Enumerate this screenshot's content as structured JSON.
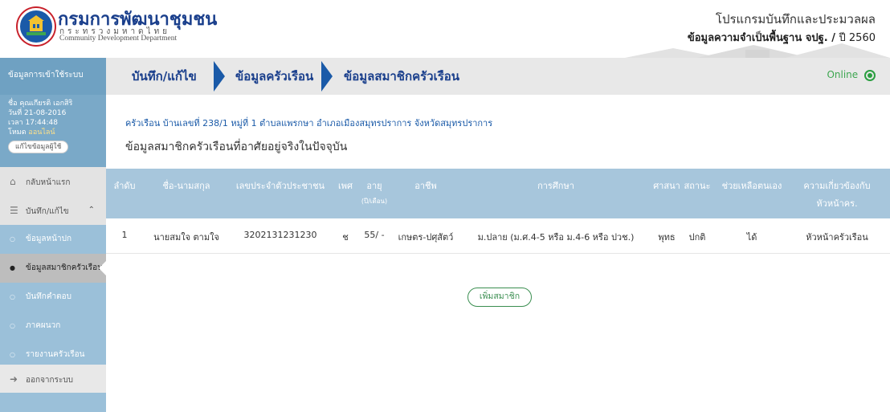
{
  "header": {
    "org_name_th": "กรมการพัฒนาชุมชน",
    "org_sub_th": "กระทรวงมหาดไทย",
    "org_name_en": "Community Development Department",
    "program_title": "โปรแกรมบันทึกและประมวลผล",
    "program_sub_bold": "ข้อมูลความจำเป็นพื้นฐาน จปฐ. / ",
    "program_sub_year": "ปี 2560"
  },
  "topbar": {
    "user_login_label": "ข้อมูลการเข้าใช้ระบบ",
    "breadcrumb": [
      "บันทึก/แก้ไข",
      "ข้อมูลครัวเรือน",
      "ข้อมูลสมาชิกครัวเรือน"
    ],
    "online_label": "Online"
  },
  "user": {
    "name_line": "ชื่อ คุณเกียรติ เอกสิริ",
    "date_line": "วันที่ 21-08-2016",
    "time_line": "เวลา 17:44:48",
    "mode_label": "โหมด",
    "mode_value": "ออนไลน์",
    "edit_label": "แก้ไขข้อมูลผู้ใช้"
  },
  "sidebar": {
    "home": "กลับหน้าแรก",
    "record_edit": "บันทึก/แก้ไข",
    "items": [
      "ข้อมูลหน้าปก",
      "ข้อมูลสมาชิกครัวเรือน",
      "บันทึกคำตอบ",
      "ภาคผนวก",
      "รายงานครัวเรือน"
    ],
    "logout": "ออกจากระบบ"
  },
  "main": {
    "address": "ครัวเรือน บ้านเลขที่ 238/1 หมู่ที่ 1 ตำบลแพรกษา อำเภอเมืองสมุทรปราการ จังหวัดสมุทรปราการ",
    "section_title": "ข้อมูลสมาชิกครัวเรือนที่อาศัยอยู่จริงในปัจจุบัน",
    "columns": [
      "ลำดับ",
      "ชื่อ-นามสกุล",
      "เลขประจำตัวประชาชน",
      "เพศ",
      "อายุ",
      "อาชีพ",
      "การศึกษา",
      "ศาสนา",
      "สถานะ",
      "ช่วยเหลือตนเอง",
      "ความเกี่ยวข้องกับ",
      "หัวหน้าคร."
    ],
    "age_sub": "(ปี/เดือน)",
    "rows": [
      {
        "no": "1",
        "name": "นายสมใจ ตามใจ",
        "id": "3202131231230",
        "sex": "ช",
        "age": "55/ -",
        "job": "เกษตร-ปศุสัตว์",
        "edu": "ม.ปลาย (ม.ศ.4-5 หรือ ม.4-6 หรือ ปวช.)",
        "religion": "พุทธ",
        "status": "ปกติ",
        "self_help": "ได้",
        "relation": "หัวหน้าครัวเรือน"
      }
    ],
    "add_member": "เพิ่มสมาชิก"
  },
  "colors": {
    "brand_blue": "#1a5aa8",
    "sidebar_blue": "#9bc0d9",
    "table_head": "#a7c6dc",
    "online_green": "#2a9e40"
  }
}
